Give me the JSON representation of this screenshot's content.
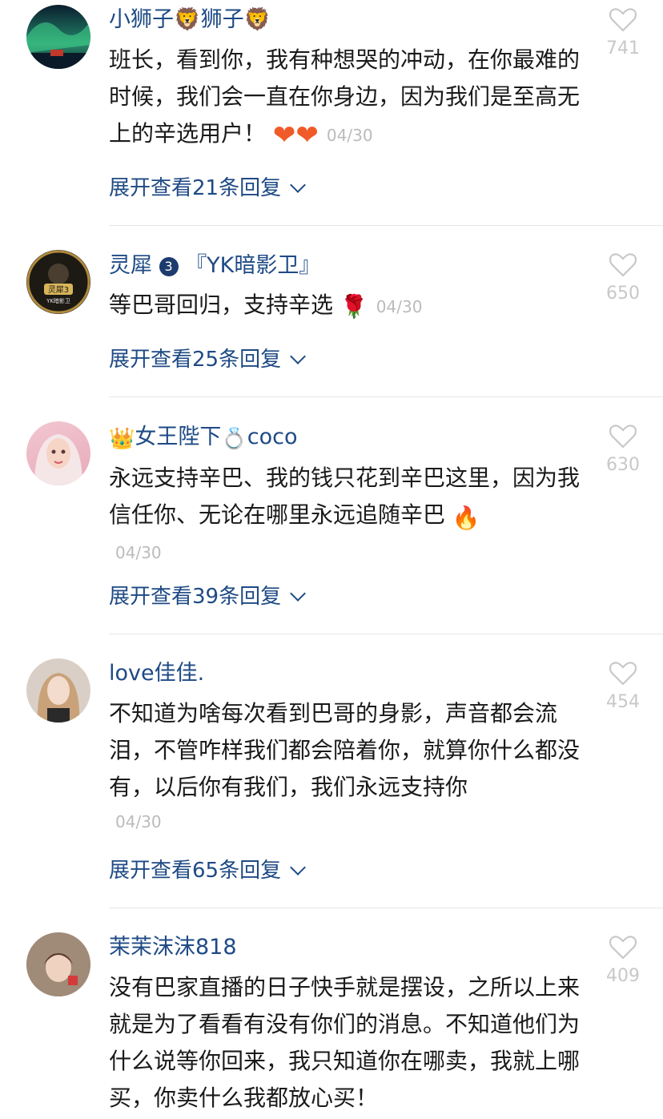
{
  "comments": [
    {
      "name": "小狮子🦁狮子🦁",
      "text": "班长，看到你，我有种想哭的冲动，在你最难的时候，我们会一直在你身边，因为我们是至高无上的辛选用户！",
      "emoji": "❤❤",
      "date": "04/30",
      "replies": "展开查看21条回复",
      "likes": "741"
    },
    {
      "name": "灵犀",
      "badge": "3",
      "tag": "『YK暗影卫』",
      "text": "等巴哥回归，支持辛选",
      "emoji": "🌹",
      "date": "04/30",
      "replies": "展开查看25条回复",
      "likes": "650",
      "avatar_text": "灵犀3",
      "avatar_sub": "YK暗影卫"
    },
    {
      "name_prefix": "👑",
      "name": "女王陛下",
      "name_mid": "💍",
      "name_suffix": "coco",
      "text": "永远支持辛巴、我的钱只花到辛巴这里，因为我信任你、无论在哪里永远追随辛巴",
      "emoji": "🔥",
      "date": "04/30",
      "replies": "展开查看39条回复",
      "likes": "630"
    },
    {
      "name": "love佳佳.",
      "text": "不知道为啥每次看到巴哥的身影，声音都会流泪，不管咋样我们都会陪着你，就算你什么都没有，以后你有我们，我们永远支持你",
      "date": "04/30",
      "replies": "展开查看65条回复",
      "likes": "454"
    },
    {
      "name": "茉茉沫沫818",
      "text": "没有巴家直播的日子快手就是摆设，之所以上来就是为了看看有没有你们的消息。不知道他们为什么说等你回来，我只知道你在哪卖，我就上哪买，你卖什么我都放心买！",
      "likes": "409"
    }
  ]
}
